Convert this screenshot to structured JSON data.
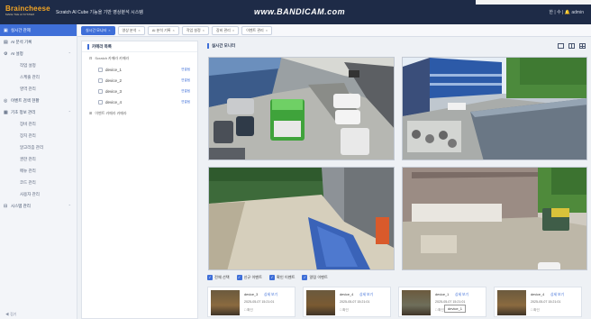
{
  "app": {
    "brand": "Braincheese",
    "brand_sub": "MAKE THE AI SYSTEM",
    "title": "Scratch AI Cube 기능을 기반 영상분석 시스템",
    "watermark": "www.BANDICAM.com",
    "top_right": "한 | 수 | 🔔 admin"
  },
  "tabs": [
    {
      "label": "실시간 모니터",
      "active": true
    },
    {
      "label": "영상 분석",
      "active": false
    },
    {
      "label": "AI 분석 기록",
      "active": false
    },
    {
      "label": "작업 설정",
      "active": false
    },
    {
      "label": "장비 관리",
      "active": false
    },
    {
      "label": "이벤트 관리",
      "active": false
    }
  ],
  "sidebar": {
    "items": [
      {
        "label": "실시간 관제",
        "icon": "monitor-icon",
        "active": true,
        "sub": false
      },
      {
        "label": "AI 분석 기록",
        "icon": "chart-icon",
        "active": false,
        "sub": false
      },
      {
        "label": "AI 설정",
        "icon": "cpu-icon",
        "active": false,
        "sub": false,
        "chev": true
      },
      {
        "label": "작업 설정",
        "icon": "",
        "active": false,
        "sub": true
      },
      {
        "label": "스케줄 관리",
        "icon": "",
        "active": false,
        "sub": true
      },
      {
        "label": "영역 관리",
        "icon": "",
        "active": false,
        "sub": true
      },
      {
        "label": "이벤트 검색 현황",
        "icon": "bell-icon",
        "active": false,
        "sub": false
      },
      {
        "label": "기초 정보 관리",
        "icon": "gear-icon",
        "active": false,
        "sub": false,
        "chev": true
      },
      {
        "label": "장비 관리",
        "icon": "",
        "active": false,
        "sub": true
      },
      {
        "label": "장치 관리",
        "icon": "",
        "active": false,
        "sub": true
      },
      {
        "label": "알고리즘 관리",
        "icon": "",
        "active": false,
        "sub": true
      },
      {
        "label": "권한 관리",
        "icon": "",
        "active": false,
        "sub": true
      },
      {
        "label": "메뉴 관리",
        "icon": "",
        "active": false,
        "sub": true
      },
      {
        "label": "코드 관리",
        "icon": "",
        "active": false,
        "sub": true
      },
      {
        "label": "사용자 관리",
        "icon": "",
        "active": false,
        "sub": true
      },
      {
        "label": "시스템 관리",
        "icon": "server-icon",
        "active": false,
        "sub": false,
        "chev": true
      }
    ],
    "bottom": "◀ 접기"
  },
  "camera_panel": {
    "title": "카메라 목록",
    "group_open": "Scratch 카메라 카메라",
    "devices": [
      {
        "name": "device_1",
        "status": "연결됨"
      },
      {
        "name": "device_2",
        "status": "연결됨"
      },
      {
        "name": "device_3",
        "status": "연결됨"
      },
      {
        "name": "device_4",
        "status": "연결됨"
      }
    ],
    "group_closed": "이벤트 카메라 카메라"
  },
  "main": {
    "title": "실시간 모니터",
    "view_icons": [
      "single-view-icon",
      "grid-2-view-icon",
      "grid-4-view-icon"
    ]
  },
  "filters": [
    {
      "label": "전체 선택",
      "checked": true
    },
    {
      "label": "신규 이벤트",
      "checked": true
    },
    {
      "label": "확인 이벤트",
      "checked": true
    },
    {
      "label": "알림 이벤트",
      "checked": true
    }
  ],
  "events": [
    {
      "device": "device_3",
      "link": "상세 보기",
      "date": "2025-05-07 15:21:01",
      "meta": "□ 확인"
    },
    {
      "device": "device_4",
      "link": "상세 보기",
      "date": "2025-05-07 15:21:01",
      "meta": "□ 확인"
    },
    {
      "device": "device_1",
      "link": "상세 보기",
      "date": "2025-05-07 15:21:01",
      "meta": "□ 확인"
    },
    {
      "device": "device_4",
      "link": "상세 보기",
      "date": "2025-05-07 15:21:01",
      "meta": "□ 확인"
    }
  ],
  "tooltip": "device_1",
  "colors": {
    "topbar": "#1e2b47",
    "accent": "#3f6fd8",
    "brand": "#f5a623"
  }
}
